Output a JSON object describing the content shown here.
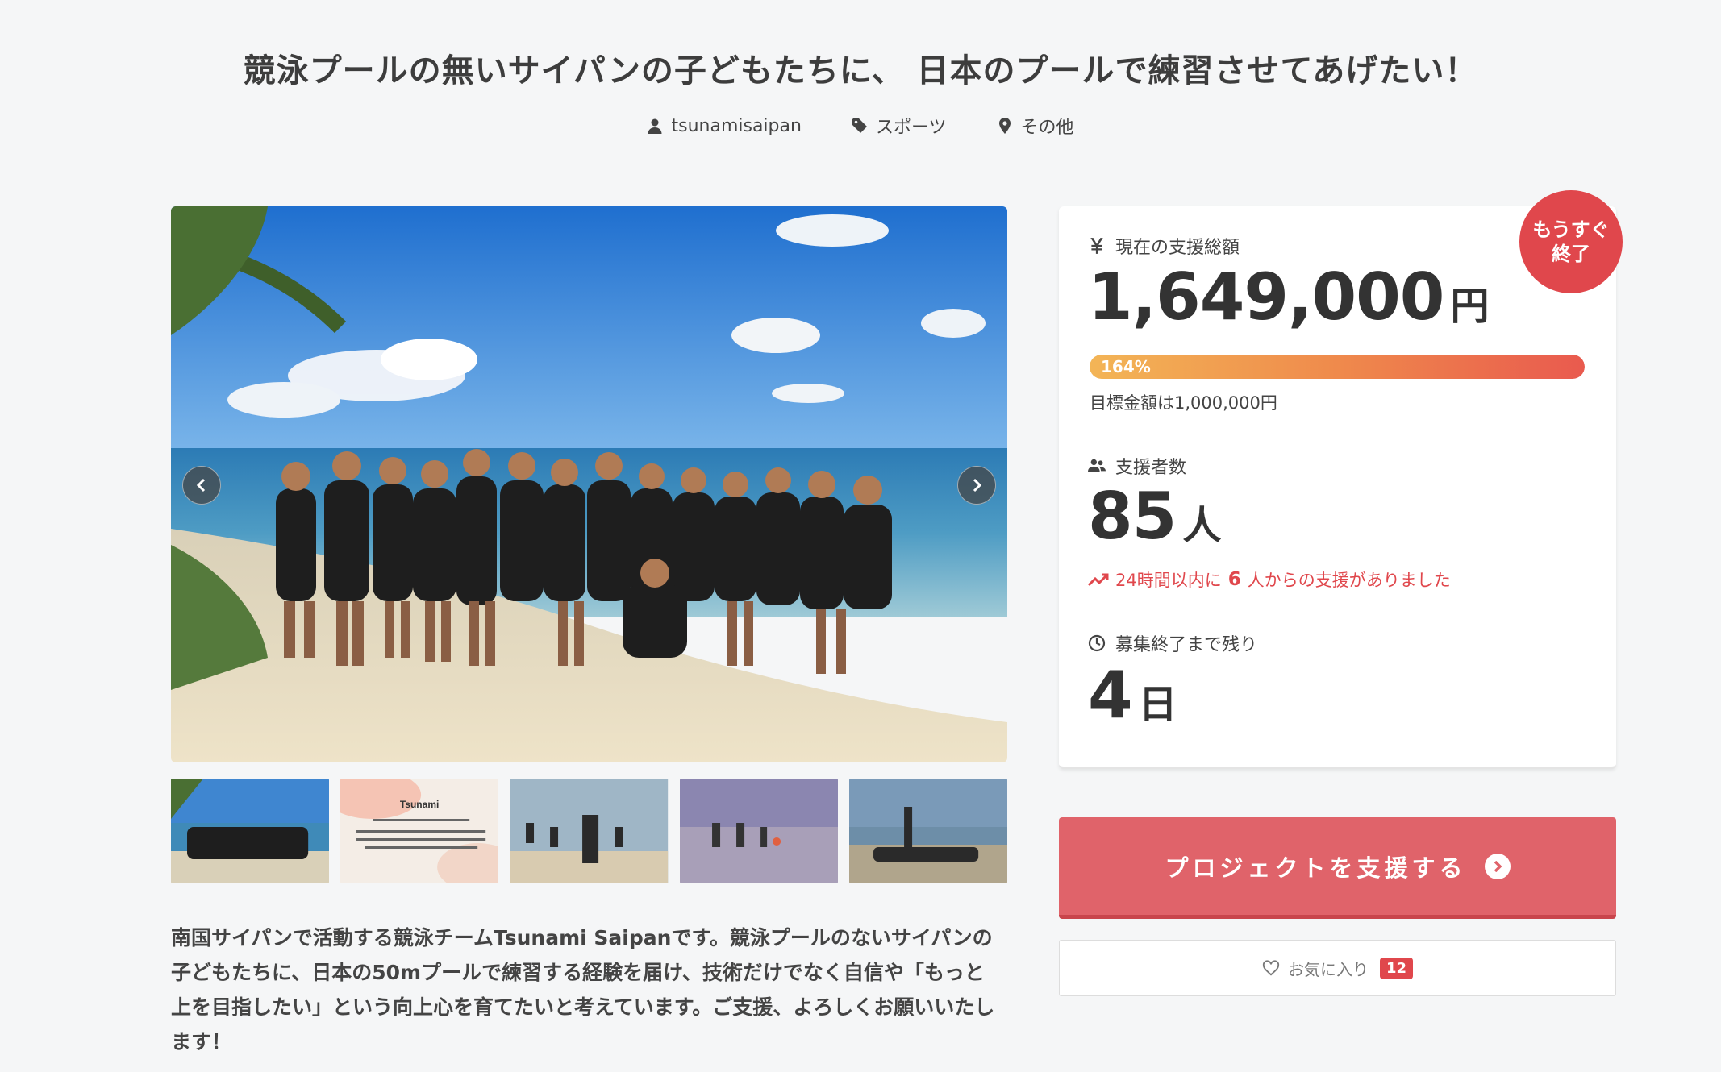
{
  "project": {
    "title": "競泳プールの無いサイパンの子どもたちに、 日本のプールで練習させてあげたい！",
    "owner": "tsunamisaipan",
    "category": "スポーツ",
    "location": "その他",
    "description": "南国サイパンで活動する競泳チームTsunami Saipanです。競泳プールのないサイパンの子どもたちに、日本の50mプールで練習する経験を届け、技術だけでなく自信や「もっと上を目指したい」という向上心を育てたいと考えています。ご支援、よろしくお願いいたします！"
  },
  "icons": {
    "owner": "user-icon",
    "category": "tag-icon",
    "location": "map-pin-icon",
    "prev": "chevron-left-icon",
    "next": "chevron-right-icon",
    "amount": "yen-icon",
    "supporters": "users-icon",
    "trend": "trending-up-icon",
    "time": "clock-icon",
    "support": "arrow-right-circle-icon",
    "favorite": "heart-icon"
  },
  "gallery": {
    "thumbnail_text": "Tsunami"
  },
  "funding": {
    "badge": "もうすぐ終了",
    "amount_label": "現在の支援総額",
    "amount": "1,649,000",
    "amount_unit": "円",
    "progress_percent": 164,
    "progress_text": "164%",
    "goal_text": "目標金額は1,000,000円",
    "supporters_label": "支援者数",
    "supporters": "85",
    "supporters_unit": "人",
    "recent_prefix": "24時間以内に",
    "recent_count": "6",
    "recent_suffix": "人からの支援がありました",
    "remaining_label": "募集終了まで残り",
    "remaining": "4",
    "remaining_unit": "日"
  },
  "actions": {
    "support_label": "プロジェクトを支援する",
    "favorite_label": "お気に入り",
    "favorite_count": "12"
  },
  "colors": {
    "accent": "#e0474c",
    "button": "#e0636a"
  }
}
